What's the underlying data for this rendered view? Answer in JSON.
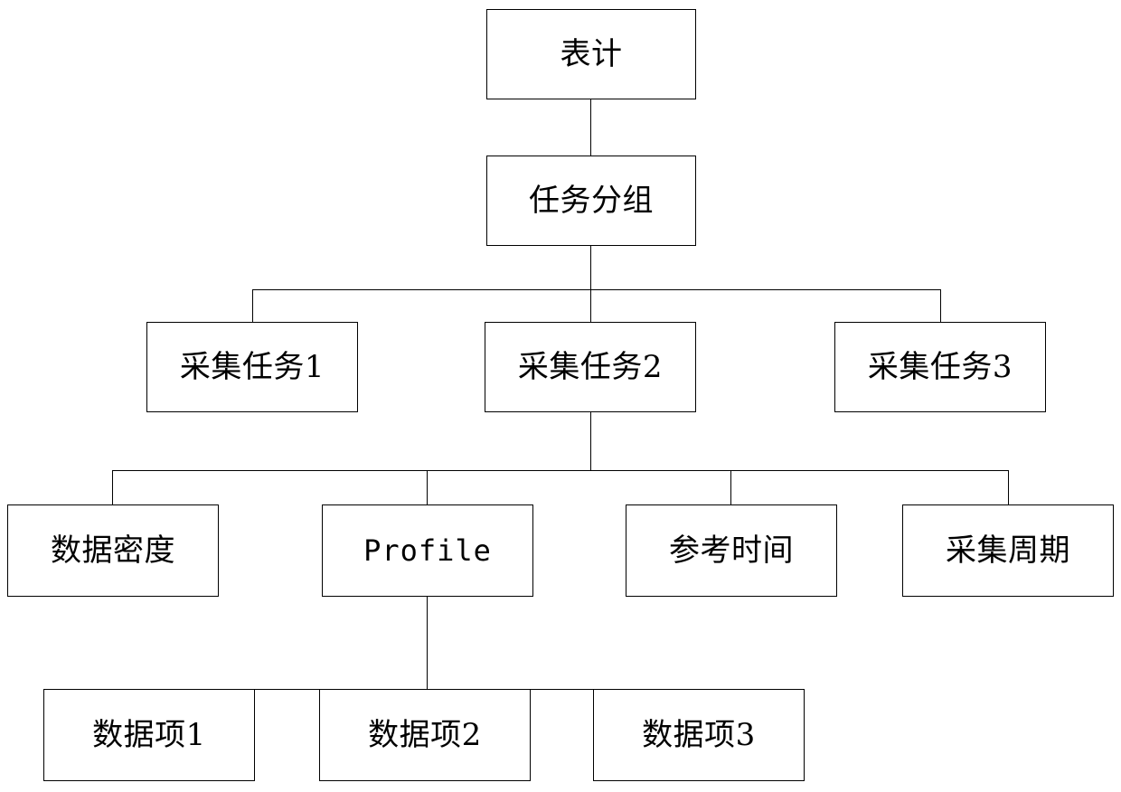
{
  "diagram": {
    "type": "tree",
    "title": "",
    "background_color": "#ffffff",
    "line_color": "#000000",
    "text_color": "#000000",
    "nodes": {
      "meter": "表计",
      "task_group": "任务分组",
      "collect_task_1": "采集任务1",
      "collect_task_2": "采集任务2",
      "collect_task_3": "采集任务3",
      "data_density": "数据密度",
      "profile": "Profile",
      "reference_time": "参考时间",
      "collect_period": "采集周期",
      "data_item_1": "数据项1",
      "data_item_2": "数据项2",
      "data_item_3": "数据项3"
    },
    "levels": [
      {
        "name": "level-1",
        "items": [
          "表计"
        ]
      },
      {
        "name": "level-2",
        "items": [
          "任务分组"
        ]
      },
      {
        "name": "level-3",
        "items": [
          "采集任务1",
          "采集任务2",
          "采集任务3"
        ]
      },
      {
        "name": "level-4",
        "items": [
          "数据密度",
          "Profile",
          "参考时间",
          "采集周期"
        ]
      },
      {
        "name": "level-5",
        "items": [
          "数据项1",
          "数据项2",
          "数据项3"
        ]
      }
    ],
    "edges": [
      {
        "from": "表计",
        "to": "任务分组"
      },
      {
        "from": "任务分组",
        "to": "采集任务1"
      },
      {
        "from": "任务分组",
        "to": "采集任务2"
      },
      {
        "from": "任务分组",
        "to": "采集任务3"
      },
      {
        "from": "采集任务2",
        "to": "数据密度"
      },
      {
        "from": "采集任务2",
        "to": "Profile"
      },
      {
        "from": "采集任务2",
        "to": "参考时间"
      },
      {
        "from": "采集任务2",
        "to": "采集周期"
      },
      {
        "from": "Profile",
        "to": "数据项1"
      },
      {
        "from": "Profile",
        "to": "数据项2"
      },
      {
        "from": "Profile",
        "to": "数据项3"
      }
    ]
  }
}
